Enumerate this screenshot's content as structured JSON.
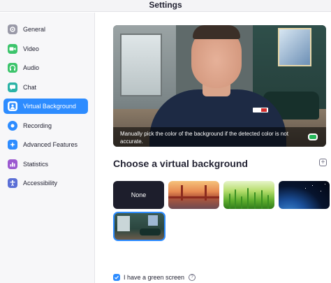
{
  "window": {
    "title": "Settings"
  },
  "sidebar": {
    "items": [
      {
        "label": "General",
        "icon": "gear-icon",
        "color": "#9a9aa8",
        "active": false
      },
      {
        "label": "Video",
        "icon": "video-camera-icon",
        "color": "#3cc46b",
        "active": false
      },
      {
        "label": "Audio",
        "icon": "headphones-icon",
        "color": "#3cc46b",
        "active": false
      },
      {
        "label": "Chat",
        "icon": "chat-bubble-icon",
        "color": "#2bb3a6",
        "active": false
      },
      {
        "label": "Virtual Background",
        "icon": "person-background-icon",
        "color": "#2d8cff",
        "active": true
      },
      {
        "label": "Recording",
        "icon": "record-icon",
        "color": "#2d8cff",
        "active": false
      },
      {
        "label": "Advanced Features",
        "icon": "advanced-features-icon",
        "color": "#2d8cff",
        "active": false
      },
      {
        "label": "Statistics",
        "icon": "statistics-icon",
        "color": "#9b59d0",
        "active": false
      },
      {
        "label": "Accessibility",
        "icon": "accessibility-icon",
        "color": "#5b6fd6",
        "active": false
      }
    ]
  },
  "preview": {
    "caption": "Manually pick the color of the background if the detected color is not accurate.",
    "detected_color": "#26b75a"
  },
  "backgrounds": {
    "heading": "Choose a virtual background",
    "add_icon": "plus-icon",
    "none_label": "None",
    "thumbnails": [
      "None",
      "Golden Gate Bridge",
      "Grass",
      "Earth from space",
      "Living room"
    ],
    "selected": "Living room"
  },
  "green_screen": {
    "label": "I have a green screen",
    "checked": true,
    "help_icon": "question-icon"
  },
  "colors": {
    "accent": "#2d8cff",
    "text": "#232333"
  }
}
